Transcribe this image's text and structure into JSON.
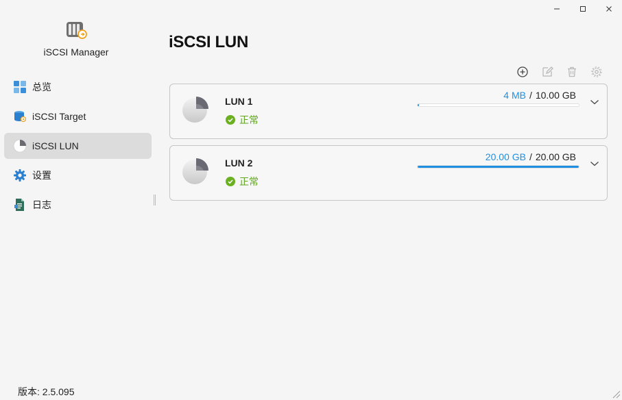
{
  "app": {
    "name": "iSCSI Manager",
    "version_label": "版本: 2.5.095"
  },
  "sidebar": {
    "items": [
      {
        "label": "总览",
        "icon": "overview-grid-icon",
        "active": false
      },
      {
        "label": "iSCSI Target",
        "icon": "target-database-icon",
        "active": false
      },
      {
        "label": "iSCSI LUN",
        "icon": "lun-pie-icon",
        "active": true
      },
      {
        "label": "设置",
        "icon": "gear-icon",
        "active": false
      },
      {
        "label": "日志",
        "icon": "log-file-icon",
        "active": false
      }
    ]
  },
  "main": {
    "title": "iSCSI LUN",
    "toolbar": [
      "add-icon",
      "edit-icon",
      "delete-icon",
      "settings-icon"
    ],
    "luns": [
      {
        "name": "LUN 1",
        "status": "正常",
        "used": "4 MB",
        "total": "10.00 GB",
        "usage_fraction": 0.0004
      },
      {
        "name": "LUN 2",
        "status": "正常",
        "used": "20.00 GB",
        "total": "20.00 GB",
        "usage_fraction": 1.0
      }
    ]
  },
  "colors": {
    "accent": "#1e8fe1",
    "status_ok": "#6bb020",
    "active_bg": "#dcdcdc"
  }
}
